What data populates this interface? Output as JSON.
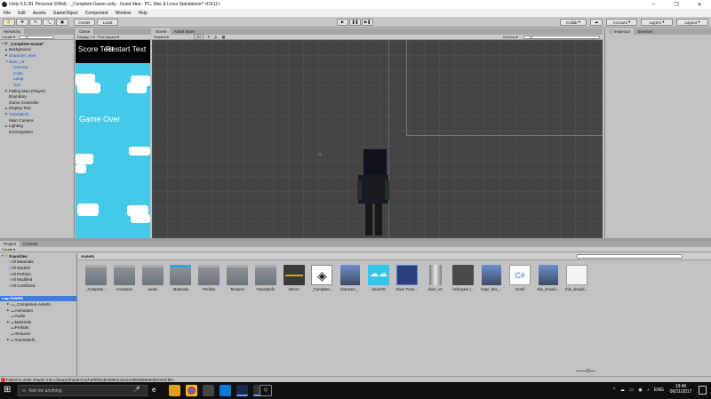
{
  "window": {
    "title": "Unity 5.6.3f1 Personal (64bit) - _Complete-Game.unity - Good Idea - PC, Mac & Linux Standalone* <DX11>"
  },
  "menu": [
    "File",
    "Edit",
    "Assets",
    "GameObject",
    "Component",
    "Window",
    "Help"
  ],
  "toolbar": {
    "center": "Center",
    "local": "Local",
    "collab": "Collab",
    "account": "Account",
    "layers": "Layers",
    "layout": "Layout"
  },
  "hierarchy": {
    "tab": "Hierarchy",
    "create": "Create",
    "search": "All",
    "scene_name": "_Complete-Game*",
    "items": [
      {
        "label": "Background",
        "indent": 1,
        "arrow": true,
        "blue": false
      },
      {
        "label": "character_new",
        "indent": 1,
        "arrow": true,
        "blue": true
      },
      {
        "label": "diver_v3",
        "indent": 1,
        "arrow": true,
        "blue": true,
        "open": true
      },
      {
        "label": "Camera",
        "indent": 2,
        "arrow": false,
        "blue": true
      },
      {
        "label": "Cube",
        "indent": 2,
        "arrow": false,
        "blue": true
      },
      {
        "label": "Lamp",
        "indent": 2,
        "arrow": false,
        "blue": true
      },
      {
        "label": "Sun",
        "indent": 2,
        "arrow": false,
        "blue": true
      },
      {
        "label": "Falling Man (Player)",
        "indent": 1,
        "arrow": true,
        "blue": false
      },
      {
        "label": "Boundary",
        "indent": 1,
        "arrow": false,
        "blue": false
      },
      {
        "label": "Game Controller",
        "indent": 1,
        "arrow": false,
        "blue": false
      },
      {
        "label": "Display Text",
        "indent": 1,
        "arrow": true,
        "blue": false
      },
      {
        "label": "TutorialInfo",
        "indent": 1,
        "arrow": true,
        "blue": true
      },
      {
        "label": "Main Camera",
        "indent": 1,
        "arrow": false,
        "blue": false
      },
      {
        "label": "Lighting",
        "indent": 1,
        "arrow": true,
        "blue": false
      },
      {
        "label": "EventSystem",
        "indent": 1,
        "arrow": false,
        "blue": false
      }
    ]
  },
  "game": {
    "tab": "Game",
    "display": "Display 1",
    "aspect": "Free Aspect",
    "score_text": "Score Text",
    "restart_text": "Restart Text",
    "game_over": "Game Over"
  },
  "scene": {
    "tab_scene": "Scene",
    "tab_asset_store": "Asset Store",
    "shaded": "Shaded",
    "mode_2d": "2D",
    "gizmos": "Gizmos",
    "search": "All"
  },
  "inspector": {
    "tab": "Inspector",
    "services": "Services"
  },
  "project": {
    "tab_project": "Project",
    "tab_console": "Console",
    "create": "Create",
    "favorites_header": "Favorites",
    "favorites": [
      "All Materials",
      "All Models",
      "All Prefabs",
      "All Modified",
      "All Conflicted"
    ],
    "assets_header": "Assets",
    "tree": [
      {
        "label": "_Completed-Assets",
        "arrow": true
      },
      {
        "label": "Animation",
        "arrow": true
      },
      {
        "label": "Audio",
        "arrow": false
      },
      {
        "label": "Materials",
        "arrow": true
      },
      {
        "label": "Prefabs",
        "arrow": false
      },
      {
        "label": "Textures",
        "arrow": false
      },
      {
        "label": "TutorialInfo",
        "arrow": true
      }
    ],
    "breadcrumb": "Assets",
    "grid": [
      {
        "label": "_Complete...",
        "kind": "folder"
      },
      {
        "label": "Animation",
        "kind": "folder"
      },
      {
        "label": "Audio",
        "kind": "folder"
      },
      {
        "label": "Materials",
        "kind": "folder-badge"
      },
      {
        "label": "Prefabs",
        "kind": "folder"
      },
      {
        "label": "Textures",
        "kind": "folder"
      },
      {
        "label": "TutorialInfo",
        "kind": "folder"
      },
      {
        "label": "3dCon",
        "kind": "model"
      },
      {
        "label": "_Complete...",
        "kind": "unity"
      },
      {
        "label": "character_...",
        "kind": "char"
      },
      {
        "label": "cloud Rc",
        "kind": "cloud"
      },
      {
        "label": "Diver Textu...",
        "kind": "texture"
      },
      {
        "label": "diver_v3",
        "kind": "diver"
      },
      {
        "label": "helicopter (...",
        "kind": "heli"
      },
      {
        "label": "hope_this_...",
        "kind": "char"
      },
      {
        "label": "Scroll",
        "kind": "script"
      },
      {
        "label": "this_should...",
        "kind": "char"
      },
      {
        "label": "this_should...",
        "kind": "doc"
      }
    ]
  },
  "status": {
    "message": "Failed to write shader into Library/ShaderCache/9/92c8c6963142a1e9384986e6d34c0cd.bin."
  },
  "taskbar": {
    "search_placeholder": "Ask me anything",
    "language": "ENG",
    "time": "19:46",
    "date": "06/11/2017"
  }
}
